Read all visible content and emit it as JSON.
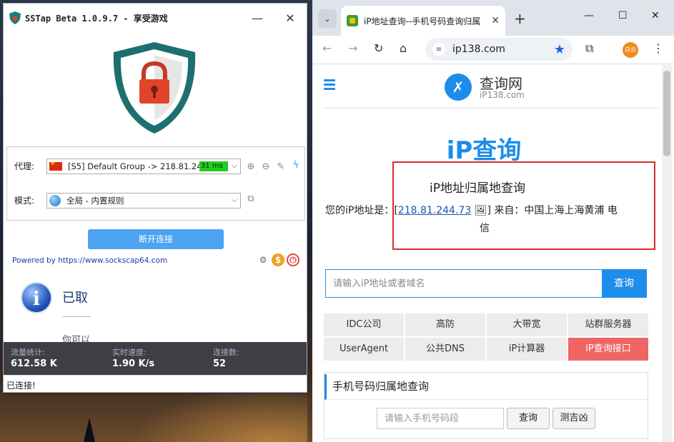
{
  "sstap": {
    "title": "SSTap Beta 1.0.9.7 - 享受游戏",
    "proxy_label": "代理:",
    "proxy_value": "[S5] Default Group -> 218.81.24...",
    "ping": "31 ms",
    "mode_label": "模式:",
    "mode_value": "全局 - 内置规则",
    "disconnect_label": "断开连接",
    "powered_by": "Powered by https://www.sockscap64.com",
    "info_title": "已取",
    "info_sub": "你可以",
    "stats": {
      "traffic_label": "流量统计:",
      "traffic_value": "612.58 K",
      "speed_label": "实时速度:",
      "speed_value": "1.90 K/s",
      "conn_label": "连接数:",
      "conn_value": "52"
    },
    "status": "已连接!"
  },
  "chrome": {
    "tab_title": "iP地址查询--手机号码查询归属",
    "url": "ip138.com",
    "avatar_text": "白云"
  },
  "page": {
    "brand_name": "查询网",
    "brand_sub": "iP138.com",
    "heading": "iP查询",
    "result_title": "iP地址归属地查询",
    "your_ip_prefix": "您的iP地址是：[",
    "ip": "218.81.244.73",
    "your_ip_suffix": "] 来自：中国上海上海黄浦 电",
    "result_tail": "信",
    "search_placeholder": "请输入iP地址或者域名",
    "search_button": "查询",
    "links": [
      "IDC公司",
      "高防",
      "大带宽",
      "站群服务器",
      "UserAgent",
      "公共DNS",
      "iP计算器",
      "iP查询接口"
    ],
    "phone_title": "手机号码归属地查询",
    "phone_placeholder": "请输入手机号码段",
    "phone_query": "查询",
    "phone_luck": "测吉凶"
  },
  "colors": {
    "accent": "#1c8dea",
    "highlight_box": "#d72b2b",
    "api_link": "#f06464",
    "ping_ok": "#22cc22"
  }
}
